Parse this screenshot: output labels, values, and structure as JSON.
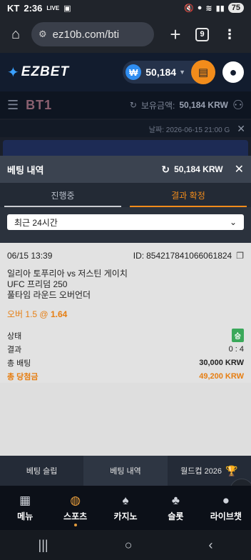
{
  "status_bar": {
    "carrier": "KT",
    "time": "2:36",
    "live_badge": "LIVE",
    "battery": "75"
  },
  "browser": {
    "url": "ez10b.com/bti",
    "tab_count": "9"
  },
  "site_header": {
    "logo_text": "EZBET",
    "balance": "50,184",
    "currency_symbol": "₩"
  },
  "sub_header": {
    "sportsbook_logo": "BT1",
    "balance_label": "보유금액:",
    "balance_value": "50,184 KRW",
    "date_text": "날짜: 2026-06-15 21:00 G"
  },
  "bet_panel": {
    "title": "베팅 내역",
    "balance": "50,184 KRW",
    "tabs": [
      {
        "label": "진행중",
        "active": false
      },
      {
        "label": "결과 확정",
        "active": true
      }
    ],
    "filter": {
      "selected": "최근 24시간"
    },
    "bet": {
      "datetime": "06/15 13:39",
      "id_label": "ID:",
      "id": "854217841066061824",
      "match": "일리아 토푸리아 vs 저스틴 게이치",
      "event": "UFC 프리덤 250",
      "market": "풀타임 라운드 오버언더",
      "selection": "오버 1.5 @",
      "odds": "1.64",
      "rows": {
        "status_label": "상태",
        "status_value": "승",
        "result_label": "결과",
        "result_value": "0 : 4",
        "stake_label": "총 배팅",
        "stake_value": "30,000 KRW",
        "payout_label": "총 당첨금",
        "payout_value": "49,200 KRW"
      }
    }
  },
  "bottom_tabs": [
    {
      "label": "베팅 슬립"
    },
    {
      "label": "베팅 내역"
    },
    {
      "label": "월드컵 2026"
    }
  ],
  "bottom_nav": [
    {
      "label": "메뉴",
      "icon": "menu-grid-icon"
    },
    {
      "label": "스포츠",
      "icon": "basketball-icon"
    },
    {
      "label": "카지노",
      "icon": "cards-icon"
    },
    {
      "label": "슬롯",
      "icon": "cherry-icon"
    },
    {
      "label": "라이브챗",
      "icon": "chat-icon"
    }
  ],
  "colors": {
    "accent": "#f28c1b",
    "win": "#3aa85a",
    "header_bg": "#121c2e"
  }
}
